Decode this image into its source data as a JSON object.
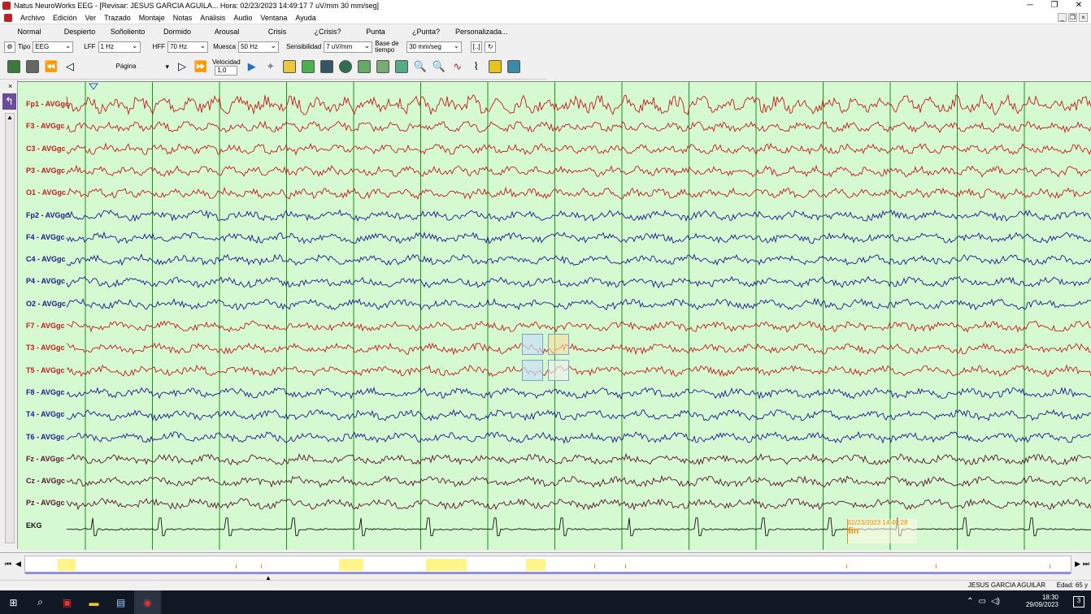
{
  "window": {
    "title": "Natus NeuroWorks EEG - [Revisar:   JESUS  GARCIA AGUILA...   Hora: 02/23/2023 14:49:17   7 uV/mm   30 mm/seg]"
  },
  "menu": [
    "Archivo",
    "Edición",
    "Ver",
    "Trazado",
    "Montaje",
    "Notas",
    "Análisis",
    "Audio",
    "Ventana",
    "Ayuda"
  ],
  "states": [
    "Normal",
    "Despierto",
    "Soñoliento",
    "Dormido",
    "Arousal",
    "Crisis",
    "¿Crisis?",
    "Punta",
    "¿Punta?",
    "Personalizada..."
  ],
  "filters": {
    "tipo_label": "Tipo",
    "tipo_value": "EEG",
    "lff_label": "LFF",
    "lff_value": "1 Hz",
    "hff_label": "HFF",
    "hff_value": "70 Hz",
    "muesca_label": "Muesca",
    "muesca_value": "50 Hz",
    "sens_label": "Sensibilidad",
    "sens_value": "7 uV/mm",
    "base_label": "Base de tiempo",
    "base_value": "30 mm/seg"
  },
  "toolbar": {
    "page_label": "Página",
    "velocity_label": "Velocidad",
    "velocity_value": "1,0"
  },
  "channels": [
    {
      "label": "Fp1 - AVGgc",
      "color": "#c41c1c"
    },
    {
      "label": "F3 - AVGgc",
      "color": "#c41c1c"
    },
    {
      "label": "C3 - AVGgc",
      "color": "#c41c1c"
    },
    {
      "label": "P3 - AVGgc",
      "color": "#c41c1c"
    },
    {
      "label": "O1 - AVGgc",
      "color": "#c41c1c"
    },
    {
      "label": "Fp2 - AVGgc",
      "color": "#1a1a8c"
    },
    {
      "label": "F4 - AVGgc",
      "color": "#1a1a8c"
    },
    {
      "label": "C4 - AVGgc",
      "color": "#1a1a8c"
    },
    {
      "label": "P4 - AVGgc",
      "color": "#1a1a8c"
    },
    {
      "label": "O2 - AVGgc",
      "color": "#1a1a8c"
    },
    {
      "label": "F7 - AVGgc",
      "color": "#c41c1c"
    },
    {
      "label": "T3 - AVGgc",
      "color": "#c41c1c"
    },
    {
      "label": "T5 - AVGgc",
      "color": "#c41c1c"
    },
    {
      "label": "F8 - AVGgc",
      "color": "#1a1a8c"
    },
    {
      "label": "T4 - AVGgc",
      "color": "#1a1a8c"
    },
    {
      "label": "T6 - AVGgc",
      "color": "#1a1a8c"
    },
    {
      "label": "Fz - AVGgc",
      "color": "#5a1430"
    },
    {
      "label": "Cz - AVGgc",
      "color": "#5a1430"
    },
    {
      "label": "Pz - AVGgc",
      "color": "#5a1430"
    },
    {
      "label": "EKG",
      "color": "#111111"
    }
  ],
  "event": {
    "timestamp": "02/23/2023 14:49:28",
    "text": "fin"
  },
  "status": {
    "patient": "JESUS  GARCIA AGUILAR",
    "age": "Edad: 65 y"
  },
  "taskbar": {
    "time": "18:30",
    "date": "29/09/2023",
    "notifications": "3"
  },
  "colors": {
    "eeg_background": "#d5f9d1",
    "second_gridline": "#1f8f1f",
    "event_color": "#f08a00"
  }
}
